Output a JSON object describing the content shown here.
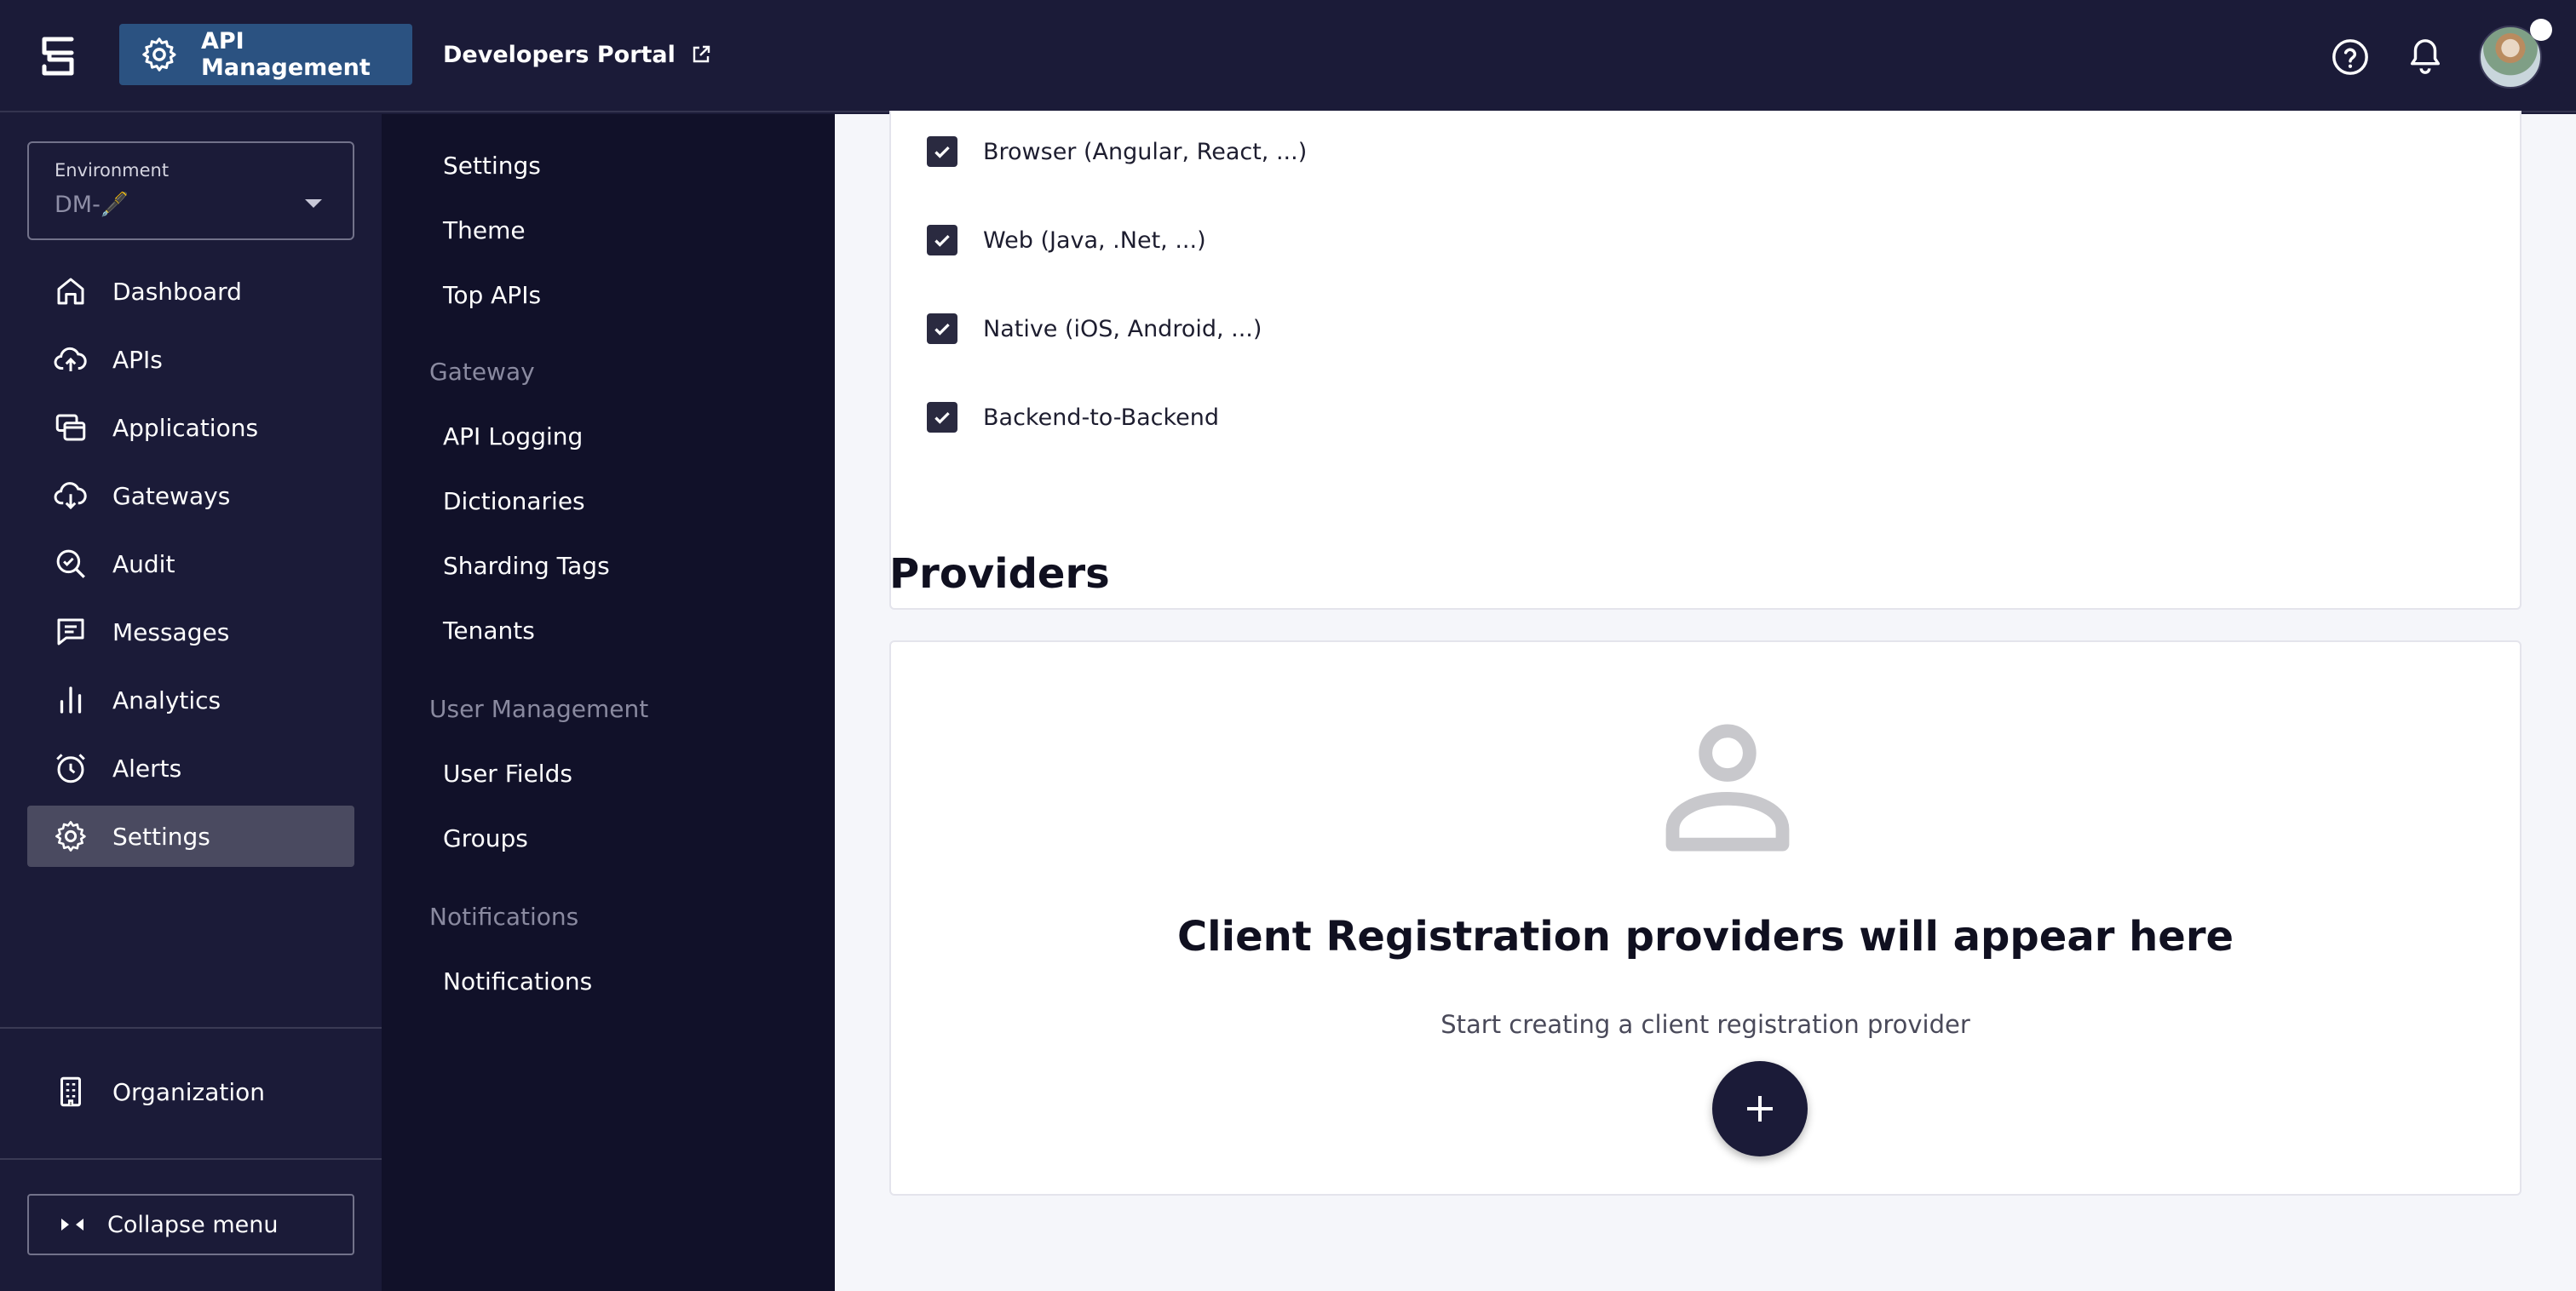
{
  "header": {
    "app_button_label": "API Management",
    "dev_portal_label": "Developers Portal"
  },
  "environment": {
    "label": "Environment",
    "value": "DM-🖋️"
  },
  "nav": {
    "items": [
      {
        "label": "Dashboard",
        "icon": "home-icon"
      },
      {
        "label": "APIs",
        "icon": "cloud-upload-icon"
      },
      {
        "label": "Applications",
        "icon": "applications-icon"
      },
      {
        "label": "Gateways",
        "icon": "cloud-download-icon"
      },
      {
        "label": "Audit",
        "icon": "audit-search-icon"
      },
      {
        "label": "Messages",
        "icon": "message-icon"
      },
      {
        "label": "Analytics",
        "icon": "bar-chart-icon"
      },
      {
        "label": "Alerts",
        "icon": "alarm-icon"
      },
      {
        "label": "Settings",
        "icon": "gear-icon",
        "active": true
      }
    ],
    "organization_label": "Organization",
    "collapse_label": "Collapse menu"
  },
  "submenu": {
    "items_top": [
      "Settings",
      "Theme",
      "Top APIs"
    ],
    "gateway_group": "Gateway",
    "gateway_items": [
      "API Logging",
      "Dictionaries",
      "Sharding Tags",
      "Tenants"
    ],
    "user_group": "User Management",
    "user_items": [
      "User Fields",
      "Groups"
    ],
    "notif_group": "Notifications",
    "notif_items": [
      "Notifications"
    ]
  },
  "client_types": [
    {
      "label": "Browser (Angular, React, ...)",
      "checked": true
    },
    {
      "label": "Web (Java, .Net, ...)",
      "checked": true
    },
    {
      "label": "Native (iOS, Android, ...)",
      "checked": true
    },
    {
      "label": "Backend-to-Backend",
      "checked": true
    }
  ],
  "providers": {
    "title": "Providers",
    "empty_title": "Client Registration providers will appear here",
    "empty_subtitle": "Start creating a client registration provider"
  },
  "colors": {
    "topbar": "#1b1b38",
    "active_app": "#2b5281",
    "submenu_bg": "#111129",
    "content_bg": "#f5f6fa"
  }
}
